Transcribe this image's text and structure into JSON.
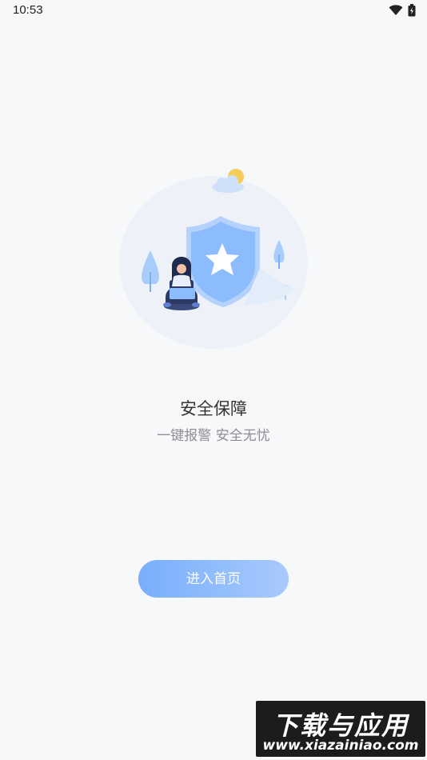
{
  "status_bar": {
    "time": "10:53",
    "icons": [
      "wifi-icon",
      "battery-icon"
    ]
  },
  "illustration": {
    "description_icon": "security-shield-illustration"
  },
  "content": {
    "title": "安全保障",
    "subtitle": "一键报警 安全无忧"
  },
  "actions": {
    "enter_label": "进入首页"
  },
  "watermark": {
    "title": "下载与应用",
    "url": "www.xiazainiao.com"
  },
  "colors": {
    "background": "#f7f8fa",
    "button_gradient_start": "#78aefc",
    "button_gradient_end": "#a8cafc",
    "shield": "#8cbcfb"
  }
}
